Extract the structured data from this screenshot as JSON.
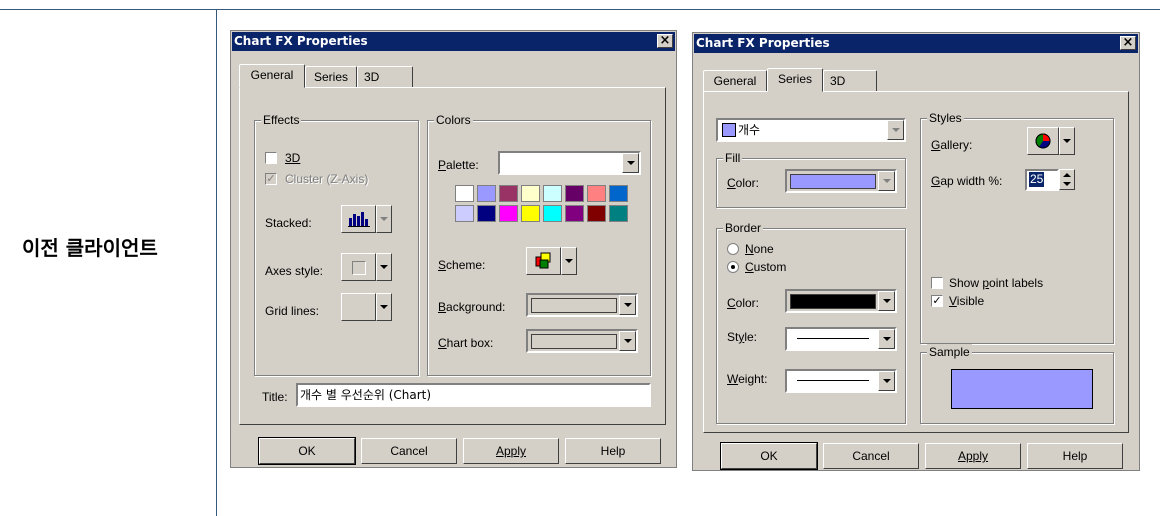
{
  "side_label": "이전 클라이언트",
  "dialog_left": {
    "title": "Chart FX Properties",
    "tabs": [
      "General",
      "Series",
      "3D"
    ],
    "effects": {
      "group": "Effects",
      "opt_3d": "3D",
      "opt_cluster": "Cluster (Z-Axis)",
      "stacked": "Stacked:",
      "axes_style": "Axes style:",
      "grid_lines": "Grid lines:"
    },
    "colors": {
      "group": "Colors",
      "palette": "Palette:",
      "scheme": "Scheme:",
      "background": "Background:",
      "chart_box": "Chart box:",
      "swatches_row1": [
        "#ffffff",
        "#9999ff",
        "#993366",
        "#ffffcc",
        "#ccffff",
        "#660066",
        "#ff8080",
        "#0066cc"
      ],
      "swatches_row2": [
        "#ccccff",
        "#000080",
        "#ff00ff",
        "#ffff00",
        "#00ffff",
        "#800080",
        "#800000",
        "#008080"
      ]
    },
    "title_label": "Title:",
    "title_value": "개수 별 우선순위 (Chart)",
    "buttons": {
      "ok": "OK",
      "cancel": "Cancel",
      "apply": "Apply",
      "help": "Help"
    }
  },
  "dialog_right": {
    "title": "Chart FX Properties",
    "tabs": [
      "General",
      "Series",
      "3D"
    ],
    "series_select": "개수",
    "fill": {
      "group": "Fill",
      "color": "Color:",
      "color_value": "#9999ff"
    },
    "border": {
      "group": "Border",
      "none": "None",
      "custom": "Custom",
      "color": "Color:",
      "style": "Style:",
      "weight": "Weight:"
    },
    "styles": {
      "group": "Styles",
      "gallery": "Gallery:",
      "gap_width": "Gap width %:",
      "gap_value": "25",
      "show_point_labels": "Show point labels",
      "visible": "Visible"
    },
    "sample": {
      "group": "Sample",
      "color": "#9999ff"
    },
    "buttons": {
      "ok": "OK",
      "cancel": "Cancel",
      "apply": "Apply",
      "help": "Help"
    }
  }
}
